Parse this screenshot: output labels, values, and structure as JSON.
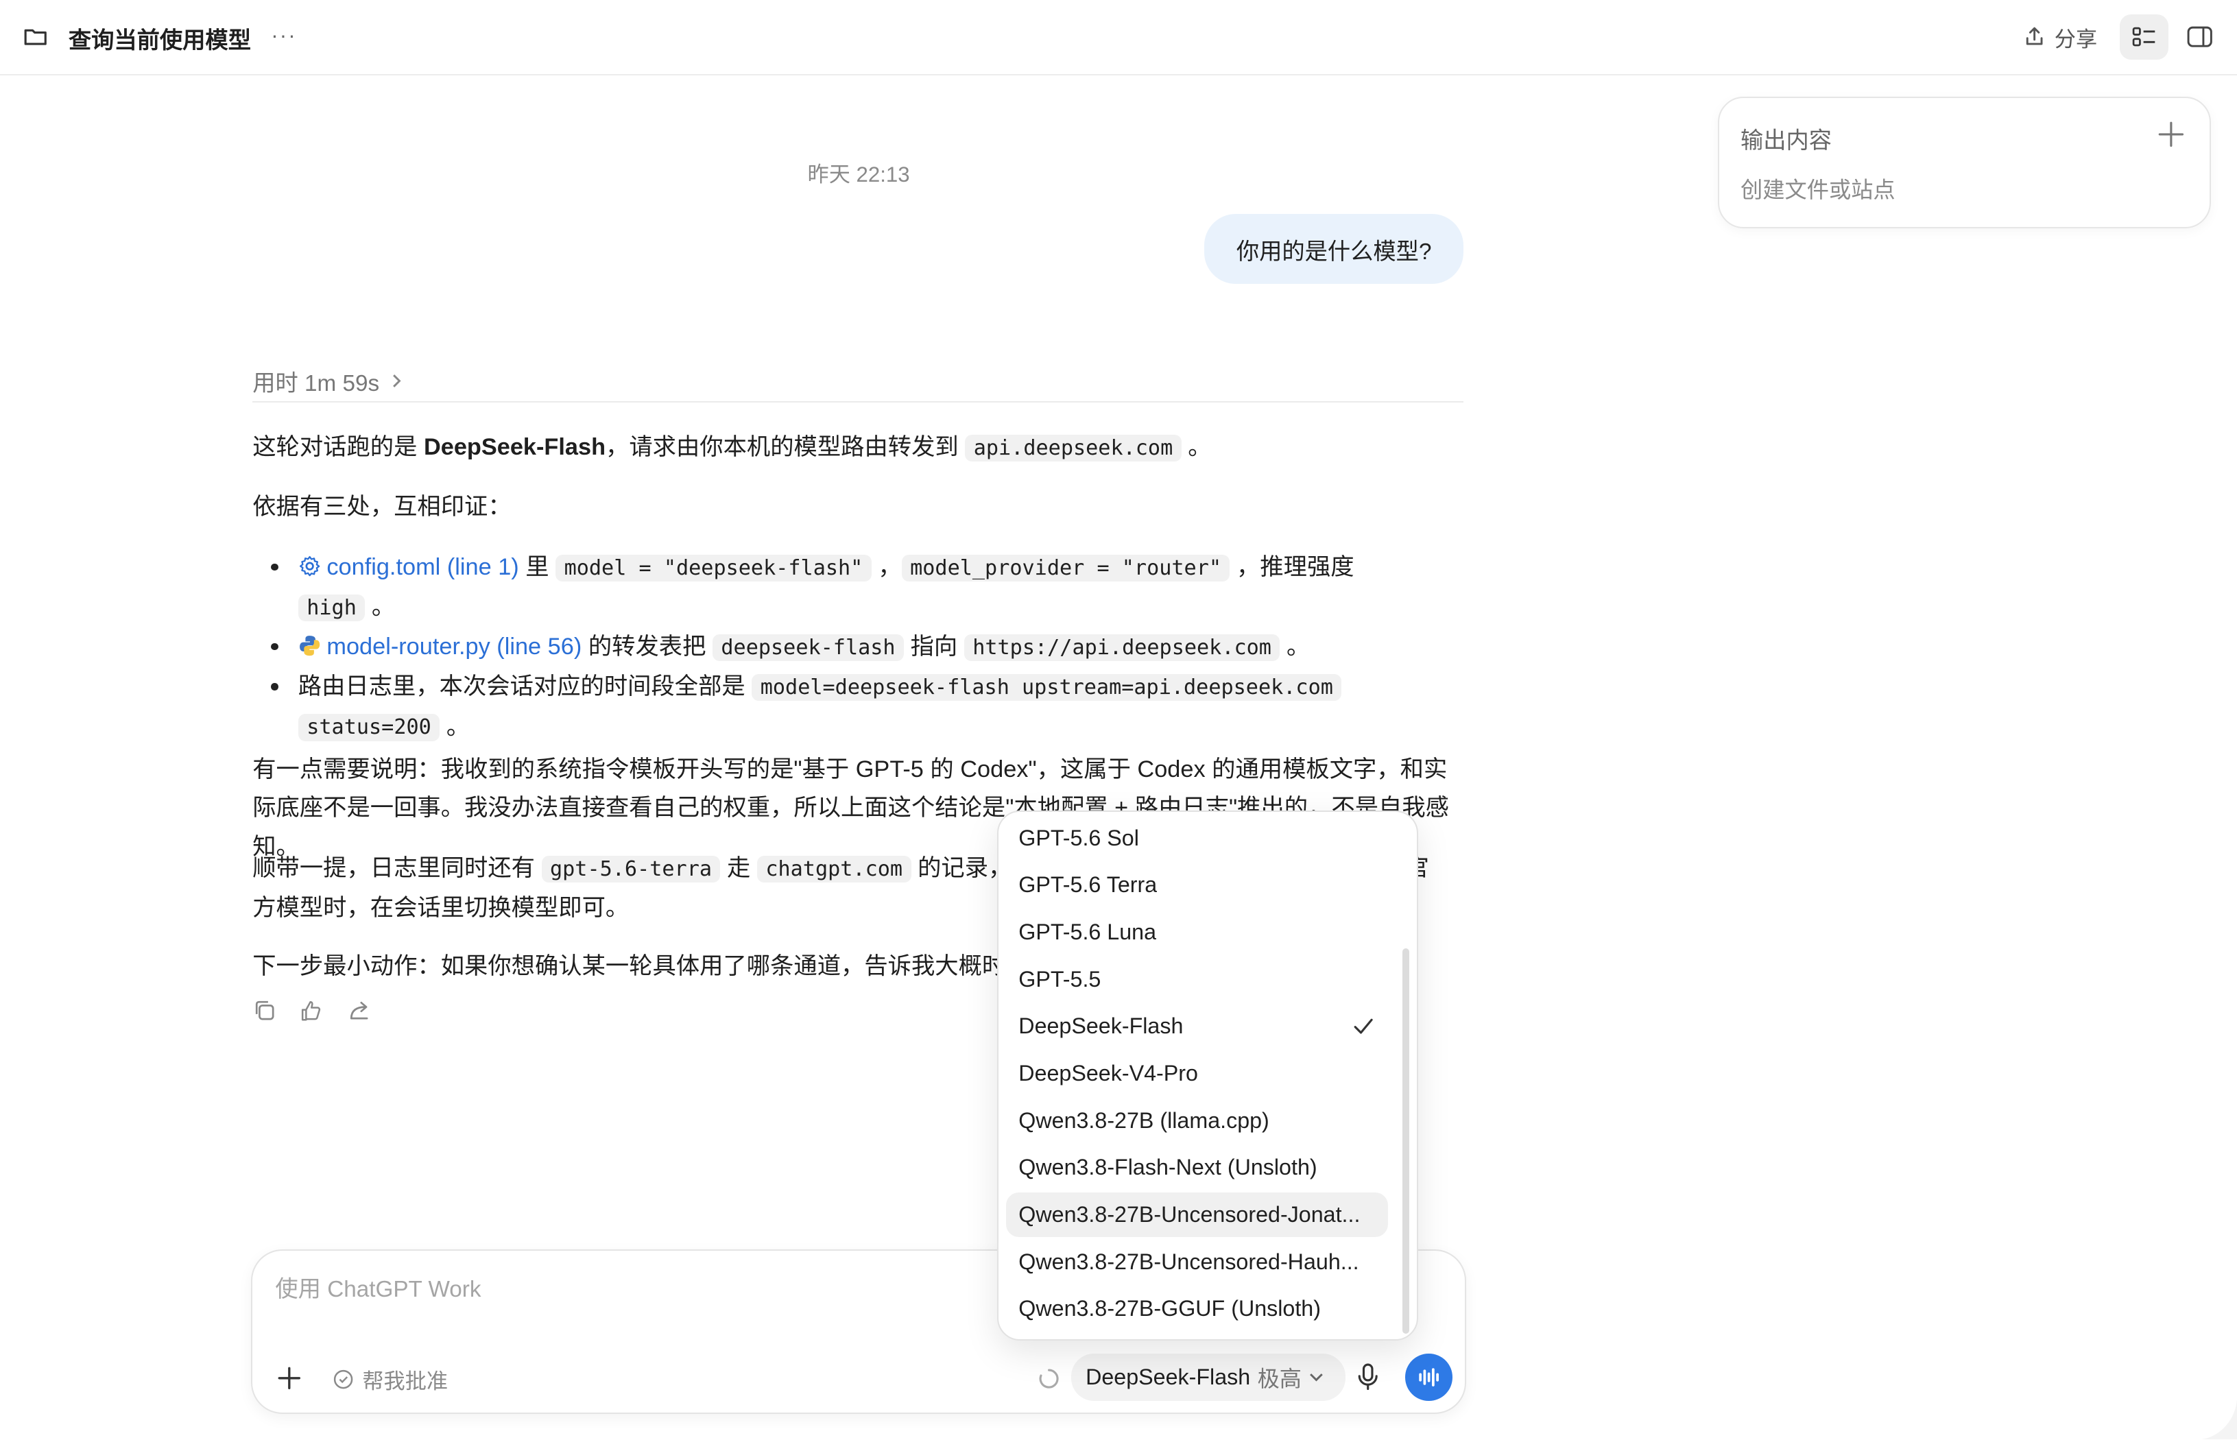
{
  "header": {
    "title": "查询当前使用模型",
    "more": "···",
    "share_label": "分享"
  },
  "output_panel": {
    "title": "输出内容",
    "subtitle": "创建文件或站点"
  },
  "conversation": {
    "timestamp": "昨天 22:13",
    "user_message": "你用的是什么模型?",
    "thought_time": "用时 1m 59s",
    "answer": {
      "p1_a": "这轮对话跑的是 ",
      "p1_b": "DeepSeek-Flash",
      "p1_c": "，请求由你本机的模型路由转发到 ",
      "p1_code": "api.deepseek.com",
      "p1_d": " 。",
      "p2": "依据有三处，互相印证：",
      "b1_link": "config.toml (line 1)",
      "b1_a": " 里 ",
      "b1_code1": "model = \"deepseek-flash\"",
      "b1_b": " ，",
      "b1_code2": "model_provider = \"router\"",
      "b1_c": " ，推理强度",
      "b1_code3": "high",
      "b1_d": " 。",
      "b2_link": "model-router.py (line 56)",
      "b2_a": " 的转发表把 ",
      "b2_code1": "deepseek-flash",
      "b2_b": " 指向 ",
      "b2_code2": "https://api.deepseek.com",
      "b2_c": " 。",
      "b3_a": "路由日志里，本次会话对应的时间段全部是 ",
      "b3_code1": "model=deepseek-flash upstream=api.deepseek.com",
      "b3_code2": "status=200",
      "b3_b": " 。",
      "p3": "有一点需要说明：我收到的系统指令模板开头写的是\"基于 GPT-5 的 Codex\"，这属于 Codex 的通用模板文字，和实际底座不是一回事。我没办法直接查看自己的权重，所以上面这个结论是\"本地配置 + 路由日志\"推出的，不是自我感知。",
      "p4_a": "顺带一提，日志里同时还有 ",
      "p4_code1": "gpt-5.6-terra",
      "p4_b": " 走 ",
      "p4_code2": "chatgpt.com",
      "p4_c": " 的记录，",
      "p4_d": "官",
      "p4_e": "方模型时，在会话里切换模型即可。",
      "p5": "下一步最小动作：如果你想确认某一轮具体用了哪条通道，告诉我大概时间"
    }
  },
  "composer": {
    "placeholder": "使用 ChatGPT Work",
    "approve_label": "帮我批准",
    "model_name": "DeepSeek-Flash",
    "effort": "极高"
  },
  "model_menu": {
    "selected": "DeepSeek-Flash",
    "items": [
      "GPT-5.6 Sol",
      "GPT-5.6 Terra",
      "GPT-5.6 Luna",
      "GPT-5.5",
      "DeepSeek-Flash",
      "DeepSeek-V4-Pro",
      "Qwen3.8-27B (llama.cpp)",
      "Qwen3.8-Flash-Next (Unsloth)",
      "Qwen3.8-27B-Uncensored-Jonat...",
      "Qwen3.8-27B-Uncensored-Hauh...",
      "Qwen3.8-27B-GGUF (Unsloth)"
    ]
  },
  "colors": {
    "accent": "#2e7ae6",
    "link": "#2b6fd6",
    "user_bubble": "#e9f2fc"
  }
}
